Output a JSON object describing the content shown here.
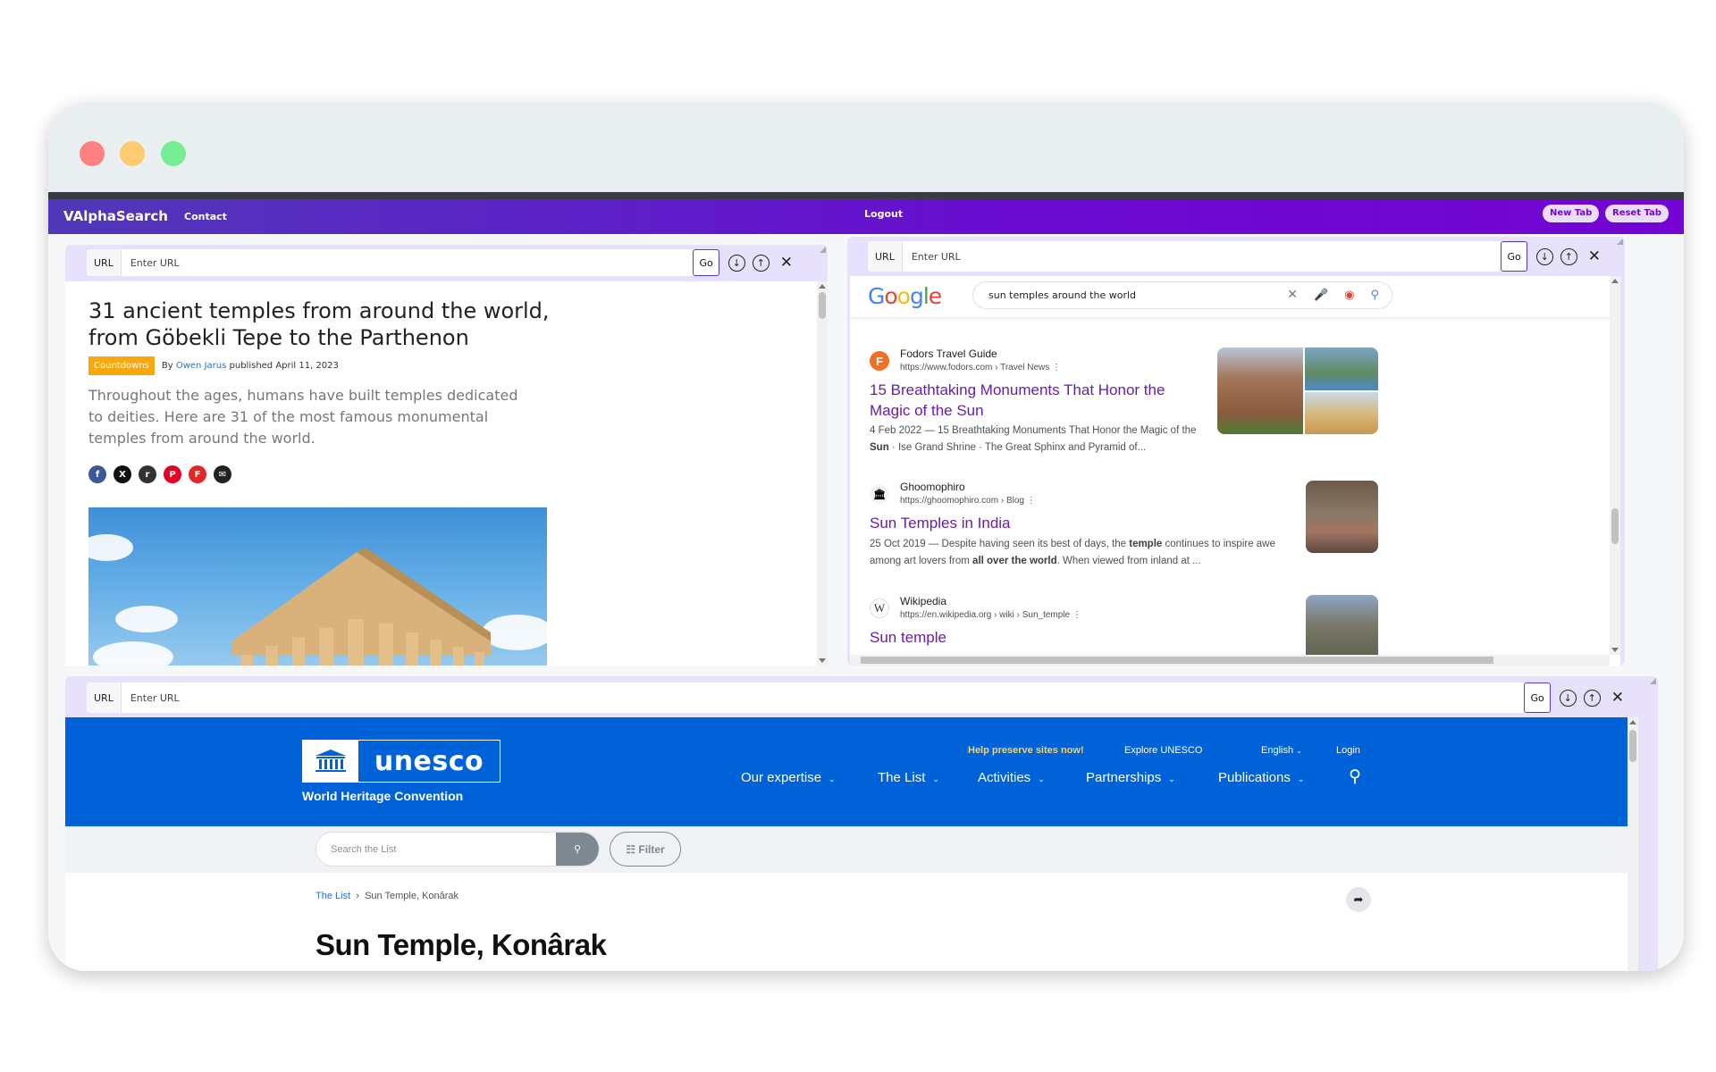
{
  "window": {
    "traffic_lights": [
      "close",
      "minimize",
      "maximize"
    ]
  },
  "appnav": {
    "brand": "VAlphaSearch",
    "contact": "Contact",
    "logout": "Logout",
    "new_tab": "New Tab",
    "reset_tab": "Reset Tab"
  },
  "panels": {
    "url_label": "URL",
    "url_placeholder": "Enter URL",
    "go": "Go",
    "down_icon": "↓",
    "up_icon": "↑",
    "close_icon": "✕"
  },
  "article": {
    "title": "31 ancient temples from around the world, from Göbekli Tepe to the Parthenon",
    "tag": "Countdowns",
    "by": "By",
    "author": "Owen Jarus",
    "published": "published April 11, 2023",
    "lede": "Throughout the ages, humans have built temples dedicated to deities. Here are 31 of the most famous monumental temples from around the world.",
    "share": [
      {
        "name": "facebook",
        "glyph": "f",
        "color": "#3b5998"
      },
      {
        "name": "x",
        "glyph": "X",
        "color": "#111111"
      },
      {
        "name": "reddit",
        "glyph": "r",
        "color": "#333333"
      },
      {
        "name": "pinterest",
        "glyph": "P",
        "color": "#e60023"
      },
      {
        "name": "flipboard",
        "glyph": "F",
        "color": "#e12828"
      },
      {
        "name": "email",
        "glyph": "✉",
        "color": "#222222"
      }
    ]
  },
  "google": {
    "logo": [
      "G",
      "o",
      "o",
      "g",
      "l",
      "e"
    ],
    "logo_colors": [
      "#4285f4",
      "#ea4335",
      "#fbbc05",
      "#4285f4",
      "#34a853",
      "#ea4335"
    ],
    "query": "sun temples around the world",
    "clear": "✕",
    "results": [
      {
        "favicon": "F",
        "site": "Fodors Travel Guide",
        "cite": "https://www.fodors.com › Travel News  ⋮",
        "title": "15 Breathtaking Monuments That Honor the Magic of the Sun",
        "snippet_date": "4 Feb 2022 — 15 Breathtaking Monuments That Honor the Magic of the ",
        "snippet_bold": "Sun",
        "snippet_rest": " · Ise Grand Shrine · The Great Sphinx and Pyramid of..."
      },
      {
        "favicon": "🏛",
        "site": "Ghoomophiro",
        "cite": "https://ghoomophiro.com › Blog  ⋮",
        "title": "Sun Temples in India",
        "snippet_a": "25 Oct 2019 — Despite having seen its best of days, the ",
        "snippet_b1": "temple",
        "snippet_c": " continues to inspire awe among art lovers from ",
        "snippet_b2": "all over the world",
        "snippet_d": ". When viewed from inland at ..."
      },
      {
        "favicon": "W",
        "site": "Wikipedia",
        "cite": "https://en.wikipedia.org › wiki › Sun_temple  ⋮",
        "title": "Sun temple"
      }
    ]
  },
  "unesco": {
    "logo_word": "unesco",
    "subtitle": "World Heritage Convention",
    "top_links": {
      "help": "Help preserve sites now!",
      "explore": "Explore UNESCO",
      "language": "English",
      "login": "Login"
    },
    "nav": [
      "Our expertise",
      "The List",
      "Activities",
      "Partnerships",
      "Publications"
    ],
    "search_placeholder": "Search the List",
    "filter": "Filter",
    "breadcrumb": {
      "root": "The List",
      "sep": "›",
      "current": "Sun Temple, Konârak"
    },
    "title": "Sun Temple, Konârak"
  }
}
